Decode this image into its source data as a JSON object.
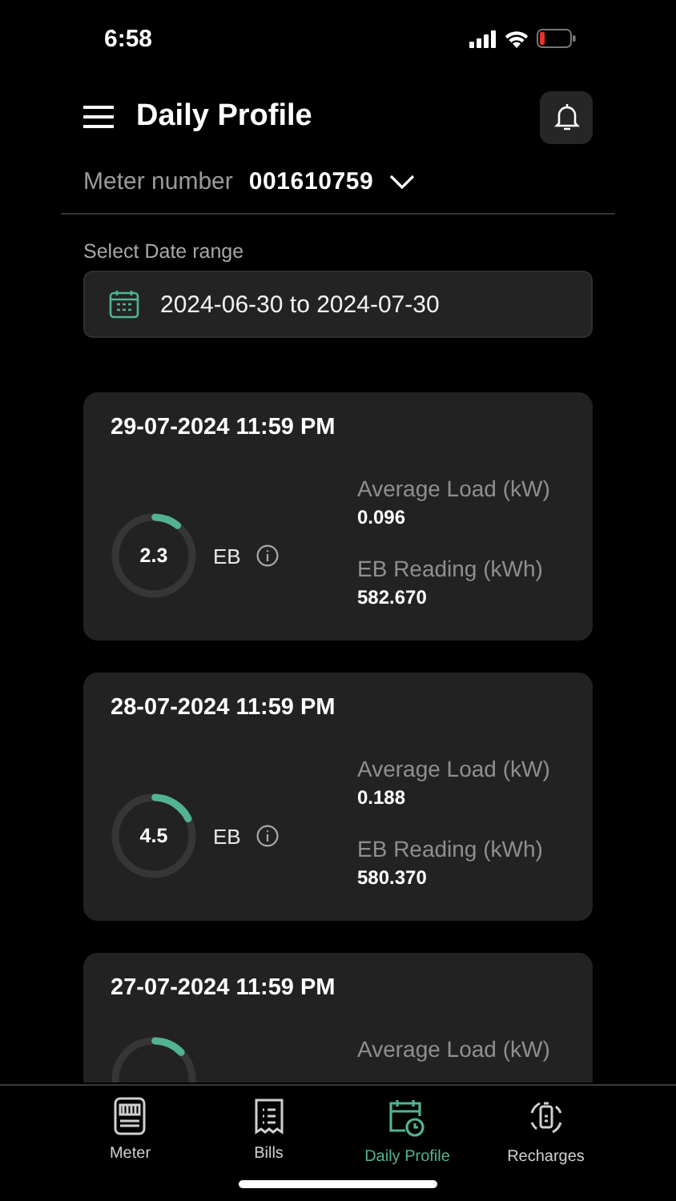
{
  "status_bar": {
    "time": "6:58"
  },
  "header": {
    "title": "Daily Profile"
  },
  "meter": {
    "label": "Meter number",
    "value": "001610759"
  },
  "date_range": {
    "label": "Select Date range",
    "value": "2024-06-30 to 2024-07-30"
  },
  "cards": [
    {
      "date": "29-07-2024 11:59 PM",
      "level": 0.1,
      "gauge_value": "2.3",
      "source": "EB",
      "load_label": "Average Load (kW)",
      "load_value": "0.096",
      "reading_label": "EB Reading (kWh)",
      "reading_value": "582.670"
    },
    {
      "date": "28-07-2024 11:59 PM",
      "level": 0.17,
      "gauge_value": "4.5",
      "source": "EB",
      "load_label": "Average Load (kW)",
      "load_value": "0.188",
      "reading_label": "EB Reading (kWh)",
      "reading_value": "580.370"
    },
    {
      "date": "27-07-2024 11:59 PM",
      "level": 0.12,
      "load_label": "Average Load (kW)"
    }
  ],
  "tabs": [
    {
      "label": "Meter",
      "kind": "meter",
      "selected": false
    },
    {
      "label": "Bills",
      "kind": "bills",
      "selected": false
    },
    {
      "label": "Daily Profile",
      "kind": "profile",
      "selected": true
    },
    {
      "label": "Recharges",
      "kind": "recharge",
      "selected": false
    }
  ]
}
